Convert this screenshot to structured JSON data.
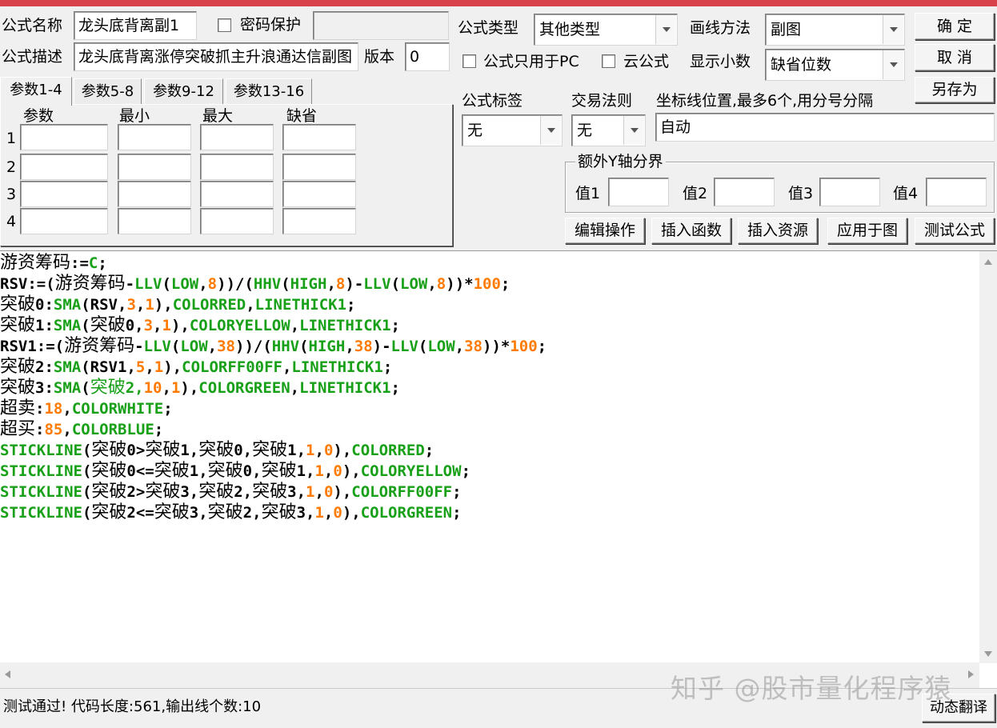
{
  "form": {
    "name_label": "公式名称",
    "name_value": "龙头底背离副1",
    "password_label": "密码保护",
    "password_value": "",
    "desc_label": "公式描述",
    "desc_value": "龙头底背离涨停突破抓主升浪通达信副图",
    "version_label": "版本",
    "version_value": "0",
    "type_label": "公式类型",
    "type_value": "其他类型",
    "draw_label": "画线方法",
    "draw_value": "副图",
    "pc_only_label": "公式只用于PC",
    "cloud_label": "云公式",
    "decimals_label": "显示小数",
    "decimals_value": "缺省位数",
    "tag_label": "公式标签",
    "tag_value": "无",
    "trade_label": "交易法则",
    "trade_value": "无",
    "coord_label": "坐标线位置,最多6个,用分号分隔",
    "coord_value": "自动",
    "yaxis_group_label": "额外Y轴分界",
    "y_values": [
      {
        "label": "值1",
        "value": ""
      },
      {
        "label": "值2",
        "value": ""
      },
      {
        "label": "值3",
        "value": ""
      },
      {
        "label": "值4",
        "value": ""
      }
    ]
  },
  "buttons": {
    "ok": "确  定",
    "cancel": "取  消",
    "save_as": "另存为",
    "edit_ops": "编辑操作",
    "insert_func": "插入函数",
    "insert_res": "插入资源",
    "apply_chart": "应用于图",
    "test": "测试公式",
    "translate": "动态翻译"
  },
  "params": {
    "tabs": [
      "参数1-4",
      "参数5-8",
      "参数9-12",
      "参数13-16"
    ],
    "headers": [
      "参数",
      "最小",
      "最大",
      "缺省"
    ],
    "rows": [
      "1",
      "2",
      "3",
      "4"
    ]
  },
  "status": "测试通过! 代码长度:561,输出线个数:10",
  "watermark": "知乎 @股市量化程序猿",
  "code_lines": [
    [
      {
        "t": "游资筹码",
        "k": "c"
      },
      {
        "t": ":=",
        "k": "p"
      },
      {
        "t": "C",
        "k": "f"
      },
      {
        "t": ";",
        "k": "p"
      }
    ],
    [
      {
        "t": "RSV:=(",
        "k": "p"
      },
      {
        "t": "游资筹码",
        "k": "c"
      },
      {
        "t": "-",
        "k": "p"
      },
      {
        "t": "LLV",
        "k": "f"
      },
      {
        "t": "(",
        "k": "p"
      },
      {
        "t": "LOW",
        "k": "f"
      },
      {
        "t": ",",
        "k": "p"
      },
      {
        "t": "8",
        "k": "n"
      },
      {
        "t": "))/(",
        "k": "p"
      },
      {
        "t": "HHV",
        "k": "f"
      },
      {
        "t": "(",
        "k": "p"
      },
      {
        "t": "HIGH",
        "k": "f"
      },
      {
        "t": ",",
        "k": "p"
      },
      {
        "t": "8",
        "k": "n"
      },
      {
        "t": ")-",
        "k": "p"
      },
      {
        "t": "LLV",
        "k": "f"
      },
      {
        "t": "(",
        "k": "p"
      },
      {
        "t": "LOW",
        "k": "f"
      },
      {
        "t": ",",
        "k": "p"
      },
      {
        "t": "8",
        "k": "n"
      },
      {
        "t": "))*",
        "k": "p"
      },
      {
        "t": "100",
        "k": "n"
      },
      {
        "t": ";",
        "k": "p"
      }
    ],
    [
      {
        "t": "突破",
        "k": "c"
      },
      {
        "t": "0:",
        "k": "p"
      },
      {
        "t": "SMA",
        "k": "f"
      },
      {
        "t": "(RSV,",
        "k": "p"
      },
      {
        "t": "3",
        "k": "n"
      },
      {
        "t": ",",
        "k": "p"
      },
      {
        "t": "1",
        "k": "n"
      },
      {
        "t": "),",
        "k": "p"
      },
      {
        "t": "COLORRED",
        "k": "f"
      },
      {
        "t": ",",
        "k": "p"
      },
      {
        "t": "LINETHICK1",
        "k": "f"
      },
      {
        "t": ";",
        "k": "p"
      }
    ],
    [
      {
        "t": "突破",
        "k": "c"
      },
      {
        "t": "1:",
        "k": "p"
      },
      {
        "t": "SMA",
        "k": "f"
      },
      {
        "t": "(",
        "k": "p"
      },
      {
        "t": "突破",
        "k": "c"
      },
      {
        "t": "0,",
        "k": "p"
      },
      {
        "t": "3",
        "k": "n"
      },
      {
        "t": ",",
        "k": "p"
      },
      {
        "t": "1",
        "k": "n"
      },
      {
        "t": "),",
        "k": "p"
      },
      {
        "t": "COLORYELLOW",
        "k": "f"
      },
      {
        "t": ",",
        "k": "p"
      },
      {
        "t": "LINETHICK1",
        "k": "f"
      },
      {
        "t": ";",
        "k": "p"
      }
    ],
    [
      {
        "t": "RSV1:=(",
        "k": "p"
      },
      {
        "t": "游资筹码",
        "k": "c"
      },
      {
        "t": "-",
        "k": "p"
      },
      {
        "t": "LLV",
        "k": "f"
      },
      {
        "t": "(",
        "k": "p"
      },
      {
        "t": "LOW",
        "k": "f"
      },
      {
        "t": ",",
        "k": "p"
      },
      {
        "t": "38",
        "k": "n"
      },
      {
        "t": "))/(",
        "k": "p"
      },
      {
        "t": "HHV",
        "k": "f"
      },
      {
        "t": "(",
        "k": "p"
      },
      {
        "t": "HIGH",
        "k": "f"
      },
      {
        "t": ",",
        "k": "p"
      },
      {
        "t": "38",
        "k": "n"
      },
      {
        "t": ")-",
        "k": "p"
      },
      {
        "t": "LLV",
        "k": "f"
      },
      {
        "t": "(",
        "k": "p"
      },
      {
        "t": "LOW",
        "k": "f"
      },
      {
        "t": ",",
        "k": "p"
      },
      {
        "t": "38",
        "k": "n"
      },
      {
        "t": "))*",
        "k": "p"
      },
      {
        "t": "100",
        "k": "n"
      },
      {
        "t": ";",
        "k": "p"
      }
    ],
    [
      {
        "t": "突破",
        "k": "c"
      },
      {
        "t": "2:",
        "k": "p"
      },
      {
        "t": "SMA",
        "k": "f"
      },
      {
        "t": "(RSV1,",
        "k": "p"
      },
      {
        "t": "5",
        "k": "n"
      },
      {
        "t": ",",
        "k": "p"
      },
      {
        "t": "1",
        "k": "n"
      },
      {
        "t": "),",
        "k": "p"
      },
      {
        "t": "COLORFF00FF",
        "k": "f"
      },
      {
        "t": ",",
        "k": "p"
      },
      {
        "t": "LINETHICK1",
        "k": "f"
      },
      {
        "t": ";",
        "k": "p"
      }
    ],
    [
      {
        "t": "突破",
        "k": "c"
      },
      {
        "t": "3:",
        "k": "p"
      },
      {
        "t": "SMA",
        "k": "f"
      },
      {
        "t": "(",
        "k": "p"
      },
      {
        "t": "突破",
        "k": "cg"
      },
      {
        "t": "2,",
        "k": "f"
      },
      {
        "t": "10",
        "k": "n"
      },
      {
        "t": ",",
        "k": "p"
      },
      {
        "t": "1",
        "k": "n"
      },
      {
        "t": "),",
        "k": "p"
      },
      {
        "t": "COLORGREEN",
        "k": "f"
      },
      {
        "t": ",",
        "k": "p"
      },
      {
        "t": "LINETHICK1",
        "k": "f"
      },
      {
        "t": ";",
        "k": "p"
      }
    ],
    [
      {
        "t": "超卖",
        "k": "c"
      },
      {
        "t": ":",
        "k": "p"
      },
      {
        "t": "18",
        "k": "n"
      },
      {
        "t": ",",
        "k": "p"
      },
      {
        "t": "COLORWHITE",
        "k": "f"
      },
      {
        "t": ";",
        "k": "p"
      }
    ],
    [
      {
        "t": "超买",
        "k": "c"
      },
      {
        "t": ":",
        "k": "p"
      },
      {
        "t": "85",
        "k": "n"
      },
      {
        "t": ",",
        "k": "p"
      },
      {
        "t": "COLORBLUE",
        "k": "f"
      },
      {
        "t": ";",
        "k": "p"
      }
    ],
    [
      {
        "t": "STICKLINE",
        "k": "f"
      },
      {
        "t": "(",
        "k": "p"
      },
      {
        "t": "突破",
        "k": "c"
      },
      {
        "t": "0>",
        "k": "p"
      },
      {
        "t": "突破",
        "k": "c"
      },
      {
        "t": "1,",
        "k": "p"
      },
      {
        "t": "突破",
        "k": "c"
      },
      {
        "t": "0,",
        "k": "p"
      },
      {
        "t": "突破",
        "k": "c"
      },
      {
        "t": "1,",
        "k": "p"
      },
      {
        "t": "1",
        "k": "n"
      },
      {
        "t": ",",
        "k": "p"
      },
      {
        "t": "0",
        "k": "n"
      },
      {
        "t": "),",
        "k": "p"
      },
      {
        "t": "COLORRED",
        "k": "f"
      },
      {
        "t": ";",
        "k": "p"
      }
    ],
    [
      {
        "t": "STICKLINE",
        "k": "f"
      },
      {
        "t": "(",
        "k": "p"
      },
      {
        "t": "突破",
        "k": "c"
      },
      {
        "t": "0<=",
        "k": "p"
      },
      {
        "t": "突破",
        "k": "c"
      },
      {
        "t": "1,",
        "k": "p"
      },
      {
        "t": "突破",
        "k": "c"
      },
      {
        "t": "0,",
        "k": "p"
      },
      {
        "t": "突破",
        "k": "c"
      },
      {
        "t": "1,",
        "k": "p"
      },
      {
        "t": "1",
        "k": "n"
      },
      {
        "t": ",",
        "k": "p"
      },
      {
        "t": "0",
        "k": "n"
      },
      {
        "t": "),",
        "k": "p"
      },
      {
        "t": "COLORYELLOW",
        "k": "f"
      },
      {
        "t": ";",
        "k": "p"
      }
    ],
    [
      {
        "t": "STICKLINE",
        "k": "f"
      },
      {
        "t": "(",
        "k": "p"
      },
      {
        "t": "突破",
        "k": "c"
      },
      {
        "t": "2>",
        "k": "p"
      },
      {
        "t": "突破",
        "k": "c"
      },
      {
        "t": "3,",
        "k": "p"
      },
      {
        "t": "突破",
        "k": "c"
      },
      {
        "t": "2,",
        "k": "p"
      },
      {
        "t": "突破",
        "k": "c"
      },
      {
        "t": "3,",
        "k": "p"
      },
      {
        "t": "1",
        "k": "n"
      },
      {
        "t": ",",
        "k": "p"
      },
      {
        "t": "0",
        "k": "n"
      },
      {
        "t": "),",
        "k": "p"
      },
      {
        "t": "COLORFF00FF",
        "k": "f"
      },
      {
        "t": ";",
        "k": "p"
      }
    ],
    [
      {
        "t": "STICKLINE",
        "k": "f"
      },
      {
        "t": "(",
        "k": "p"
      },
      {
        "t": "突破",
        "k": "c"
      },
      {
        "t": "2<=",
        "k": "p"
      },
      {
        "t": "突破",
        "k": "c"
      },
      {
        "t": "3,",
        "k": "p"
      },
      {
        "t": "突破",
        "k": "c"
      },
      {
        "t": "2,",
        "k": "p"
      },
      {
        "t": "突破",
        "k": "c"
      },
      {
        "t": "3,",
        "k": "p"
      },
      {
        "t": "1",
        "k": "n"
      },
      {
        "t": ",",
        "k": "p"
      },
      {
        "t": "0",
        "k": "n"
      },
      {
        "t": "),",
        "k": "p"
      },
      {
        "t": "COLORGREEN",
        "k": "f"
      },
      {
        "t": ";",
        "k": "p"
      }
    ]
  ],
  "colors": {
    "title_bar": "#d8434b",
    "keyword": "#18a018",
    "number": "#ff7a00",
    "text": "#000000"
  }
}
